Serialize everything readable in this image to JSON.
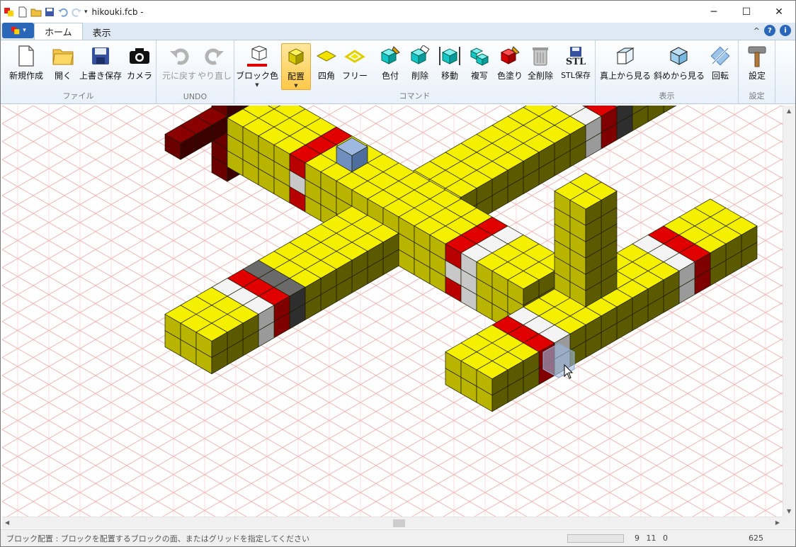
{
  "window": {
    "title": "hikouki.fcb -",
    "controls": {
      "minimize": "─",
      "maximize": "☐",
      "close": "✕"
    }
  },
  "tabs": [
    {
      "label": "ホーム",
      "active": true
    },
    {
      "label": "表示",
      "active": false
    }
  ],
  "tabs_right": {
    "collapse": "^",
    "help": "?",
    "info": "i"
  },
  "ribbon": {
    "groups": {
      "file": "ファイル",
      "undo": "UNDO",
      "command": "コマンド",
      "view": "表示",
      "settings": "設定"
    },
    "buttons": {
      "new": "新規作成",
      "open": "開く",
      "save": "上書き保存",
      "camera": "カメラ",
      "undo": "元に戻す",
      "redo": "やり直し",
      "block_color": "ブロック色",
      "place": "配置",
      "square": "四角",
      "free": "フリー",
      "paint": "色付",
      "delete": "削除",
      "move": "移動",
      "copy": "複写",
      "fill": "色塗り",
      "delete_all": "全削除",
      "stl_save": "STL保存",
      "view_top": "真上から見る",
      "view_oblique": "斜めから見る",
      "rotate": "回転",
      "settings": "設定"
    },
    "stl_glyph": "STL"
  },
  "status": {
    "message": "ブロック配置 : ブロックを配置するブロックの面、またはグリッドを指定してください",
    "coord": "9 11 0",
    "count": "625"
  },
  "colors": {
    "yellow": "#f4f000",
    "yellow_side": "#b8b400",
    "yellow_dark": "#5c5a00",
    "red": "#e10000",
    "darkred": "#6a0000",
    "white": "#f4f4f4",
    "gray": "#4e4e4e",
    "blue_cursor": "#9db9e0",
    "grid": "#f0a0a0"
  }
}
